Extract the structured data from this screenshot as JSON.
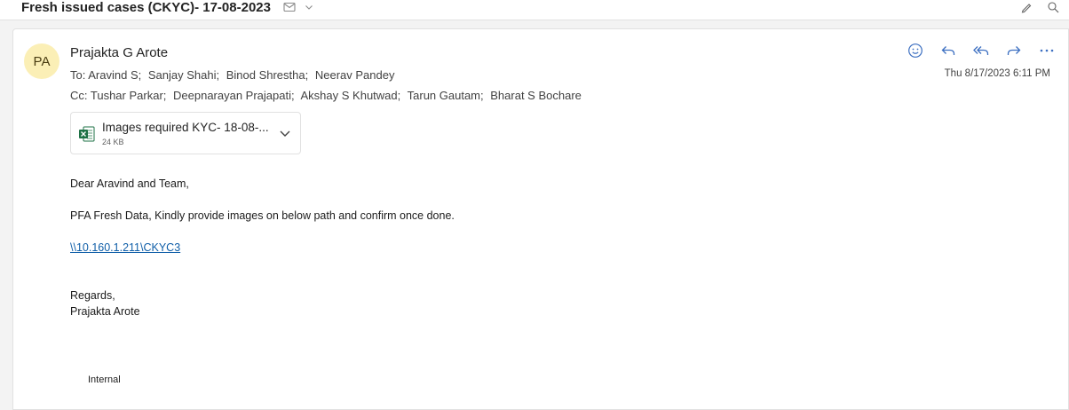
{
  "subject": {
    "title": "Fresh issued cases (CKYC)- 17-08-2023"
  },
  "message": {
    "avatar_initials": "PA",
    "sender_name": "Prajakta G Arote",
    "to_label": "To:",
    "to": [
      "Aravind S;",
      "Sanjay Shahi;",
      "Binod Shrestha;",
      "Neerav Pandey"
    ],
    "cc_label": "Cc:",
    "cc": [
      "Tushar Parkar;",
      "Deepnarayan Prajapati;",
      "Akshay S Khutwad;",
      "Tarun Gautam;",
      "Bharat S Bochare"
    ],
    "timestamp": "Thu 8/17/2023 6:11 PM"
  },
  "attachment": {
    "name": "Images required KYC- 18-08-...",
    "size": "24 KB",
    "icon": "excel-file-icon"
  },
  "body": {
    "greeting": "Dear Aravind and Team,",
    "request": "PFA Fresh Data, Kindly provide images on below path and confirm once done.",
    "link": "\\\\10.160.1.211\\CKYC3",
    "regards": "Regards,",
    "signature": "Prajakta Arote",
    "classification": "Internal"
  },
  "actions": [
    "emoji-icon",
    "reply-icon",
    "reply-all-icon",
    "forward-icon",
    "more-options-icon"
  ],
  "colors": {
    "accent": "#3c6fc1",
    "link": "#0f5ea8",
    "avatar_bg": "#fbefb6",
    "excel_green": "#1e7145"
  }
}
